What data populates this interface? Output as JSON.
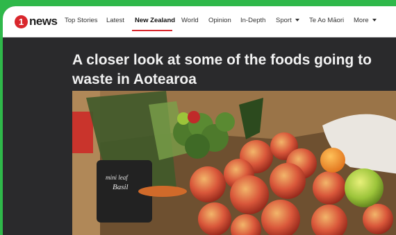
{
  "brand": {
    "badge": "1",
    "name": "news"
  },
  "nav": {
    "items": [
      {
        "label": "Top Stories"
      },
      {
        "label": "Latest"
      },
      {
        "label": "New Zealand"
      },
      {
        "label": "World"
      },
      {
        "label": "Opinion"
      },
      {
        "label": "In-Depth"
      },
      {
        "label": "Sport"
      },
      {
        "label": "Te Ao Māori"
      },
      {
        "label": "More"
      }
    ],
    "active": "New Zealand"
  },
  "article": {
    "headline_line1": "A closer look at some of the foods going to",
    "headline_line2": "waste in Aotearoa",
    "image_label_line1": "mini leaf",
    "image_label_line2": "Basil"
  },
  "colors": {
    "accent": "#d9262c",
    "frame": "#2fb84a",
    "background": "#2a2a2c"
  }
}
